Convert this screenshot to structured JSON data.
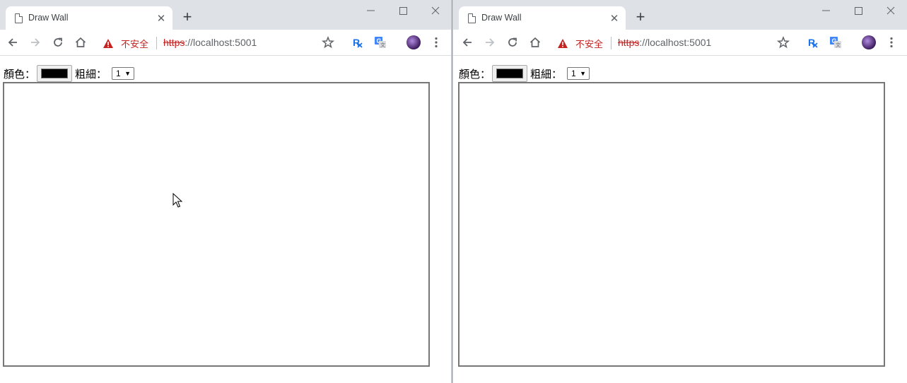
{
  "windows": [
    {
      "tab_title": "Draw Wall",
      "security_label": "不安全",
      "url_scheme": "https",
      "url_rest": "://localhost:5001",
      "page": {
        "color_label": "顏色：",
        "color_value": "#000000",
        "width_label": "粗細：",
        "width_value": "1"
      }
    },
    {
      "tab_title": "Draw Wall",
      "security_label": "不安全",
      "url_scheme": "https",
      "url_rest": "://localhost:5001",
      "page": {
        "color_label": "顏色：",
        "color_value": "#000000",
        "width_label": "粗細：",
        "width_value": "1"
      }
    }
  ],
  "colors": {
    "insecure": "#c5221f",
    "tabstrip": "#dee1e6",
    "canvas_border": "#777777",
    "extension_blue": "#1a73e8"
  },
  "icons": [
    "back-icon",
    "forward-icon",
    "reload-icon",
    "home-icon",
    "warning-icon",
    "star-icon",
    "rx-extension-icon",
    "translate-extension-icon",
    "profile-avatar",
    "menu-icon",
    "minimize-icon",
    "maximize-icon",
    "close-icon",
    "new-tab-icon",
    "document-icon",
    "mouse-cursor"
  ]
}
